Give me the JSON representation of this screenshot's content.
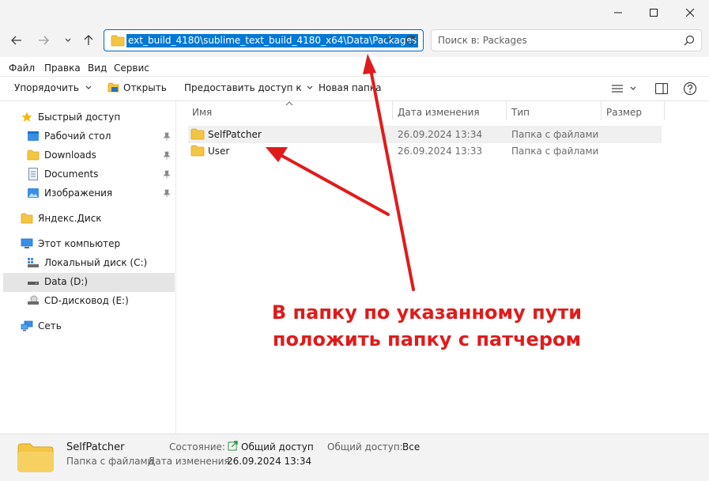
{
  "menu": {
    "file": "Файл",
    "edit": "Правка",
    "view": "Вид",
    "service": "Сервис"
  },
  "address": {
    "path": "ext_build_4180\\sublime_text_build_4180_x64\\Data\\Packages"
  },
  "search": {
    "placeholder": "Поиск в: Packages"
  },
  "toolbar": {
    "organize": "Упорядочить",
    "open": "Открыть",
    "share": "Предоставить доступ к",
    "new_folder": "Новая папка"
  },
  "sidebar": {
    "quick_access": "Быстрый доступ",
    "desktop": "Рабочий стол",
    "downloads": "Downloads",
    "documents": "Documents",
    "images": "Изображения",
    "yandex": "Яндекс.Диск",
    "this_pc": "Этот компьютер",
    "local_c": "Локальный диск (C:)",
    "data_d": "Data (D:)",
    "cd_e": "CD-дисковод (E:)",
    "network": "Сеть"
  },
  "columns": {
    "name": "Имя",
    "date": "Дата изменения",
    "type": "Тип",
    "size": "Размер"
  },
  "files": [
    {
      "name": "SelfPatcher",
      "date": "26.09.2024 13:34",
      "type": "Папка с файлами"
    },
    {
      "name": "User",
      "date": "26.09.2024 13:33",
      "type": "Папка с файлами"
    }
  ],
  "status": {
    "name": "SelfPatcher",
    "kind": "Папка с файлами",
    "state_label": "Состояние:",
    "state_value": "Общий доступ",
    "share_label": "Общий доступ:",
    "share_value": "Все",
    "date_label": "Дата изменения:",
    "date_value": "26.09.2024 13:34"
  },
  "annotation": {
    "line1": "В папку по указанному пути",
    "line2": "положить папку с патчером"
  },
  "colors": {
    "accent": "#0078d4",
    "folder": "#f4c542",
    "annotation": "#e01b1b"
  }
}
